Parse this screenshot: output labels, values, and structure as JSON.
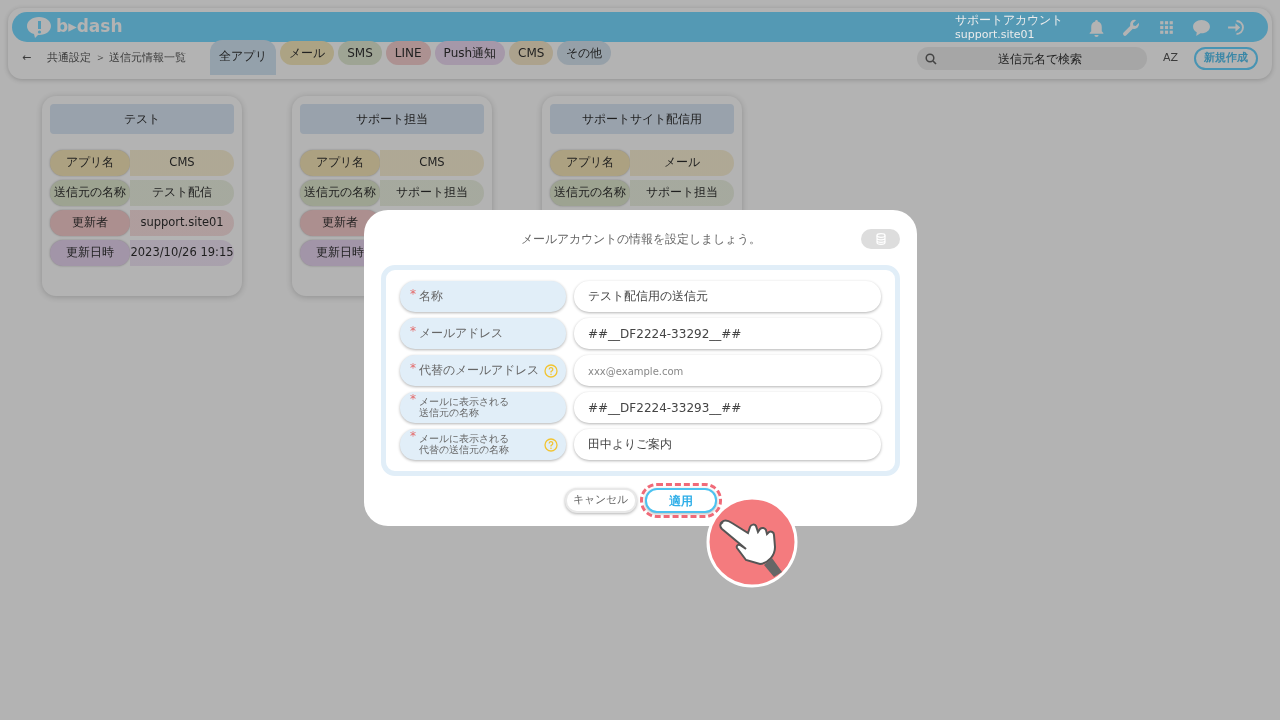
{
  "header": {
    "logo": "b▸dash",
    "account_name": "サポートアカウント",
    "account_id": "support.site01"
  },
  "toolbar": {
    "back": "←",
    "breadcrumb": "共通設定 ＞ 送信元情報一覧",
    "filters": [
      {
        "label": "全アプリ",
        "selected": true,
        "color": "#94a1ab"
      },
      {
        "label": "メール",
        "selected": false,
        "color": "#aca384"
      },
      {
        "label": "SMS",
        "selected": false,
        "color": "#9ea494"
      },
      {
        "label": "LINE",
        "selected": false,
        "color": "#ac9191"
      },
      {
        "label": "Push通知",
        "selected": false,
        "color": "#a598a9"
      },
      {
        "label": "CMS",
        "selected": false,
        "color": "#aca28d"
      },
      {
        "label": "その他",
        "selected": false,
        "color": "#96a0a8"
      }
    ],
    "search_placeholder": "送信元名で検索",
    "sort": "AZ",
    "new_button": "新規作成"
  },
  "cards": [
    {
      "title": "テスト",
      "rows": [
        {
          "label": "アプリ名",
          "value": "CMS",
          "color": "#aca181"
        },
        {
          "label": "送信元の名称",
          "value": "テスト配信",
          "color": "#9da391"
        },
        {
          "label": "更新者",
          "value": "support.site01",
          "color": "#ac8f8f"
        },
        {
          "label": "更新日時",
          "value": "2023/10/26 19:15",
          "color": "#a295a8"
        }
      ]
    },
    {
      "title": "サポート担当",
      "rows": [
        {
          "label": "アプリ名",
          "value": "CMS",
          "color": "#aca181"
        },
        {
          "label": "送信元の名称",
          "value": "サポート担当",
          "color": "#9da391"
        },
        {
          "label": "更新者",
          "color": "#ac8f8f"
        },
        {
          "label": "更新日時",
          "color": "#a295a8"
        }
      ]
    },
    {
      "title": "サポートサイト配信用",
      "rows": [
        {
          "label": "アプリ名",
          "value": "メール",
          "color": "#aca181"
        },
        {
          "label": "送信元の名称",
          "value": "サポート担当",
          "color": "#9da391"
        }
      ]
    }
  ],
  "modal": {
    "title": "メールアカウントの情報を設定しましょう。",
    "fields": [
      {
        "mark": "*",
        "label_lines": [
          "名称"
        ],
        "help": false,
        "value": "テスト配信用の送信元"
      },
      {
        "mark": "*",
        "label_lines": [
          "メールアドレス"
        ],
        "help": false,
        "value": "##__DF2224-33292__##"
      },
      {
        "mark": "*",
        "label_lines": [
          "代替のメールアドレス"
        ],
        "help": true,
        "placeholder": "xxx@example.com"
      },
      {
        "mark": "*",
        "label_lines": [
          "メールに表示される",
          "送信元の名称"
        ],
        "help": false,
        "value": "##__DF2224-33293__##"
      },
      {
        "mark": "*",
        "label_lines": [
          "メールに表示される",
          "代替の送信元の名称"
        ],
        "help": true,
        "value": "田中よりご案内"
      }
    ],
    "buttons": [
      {
        "label": "キャンセル",
        "kind": "secondary",
        "highlighted": false
      },
      {
        "label": "適用",
        "kind": "primary",
        "highlighted": true
      }
    ]
  }
}
